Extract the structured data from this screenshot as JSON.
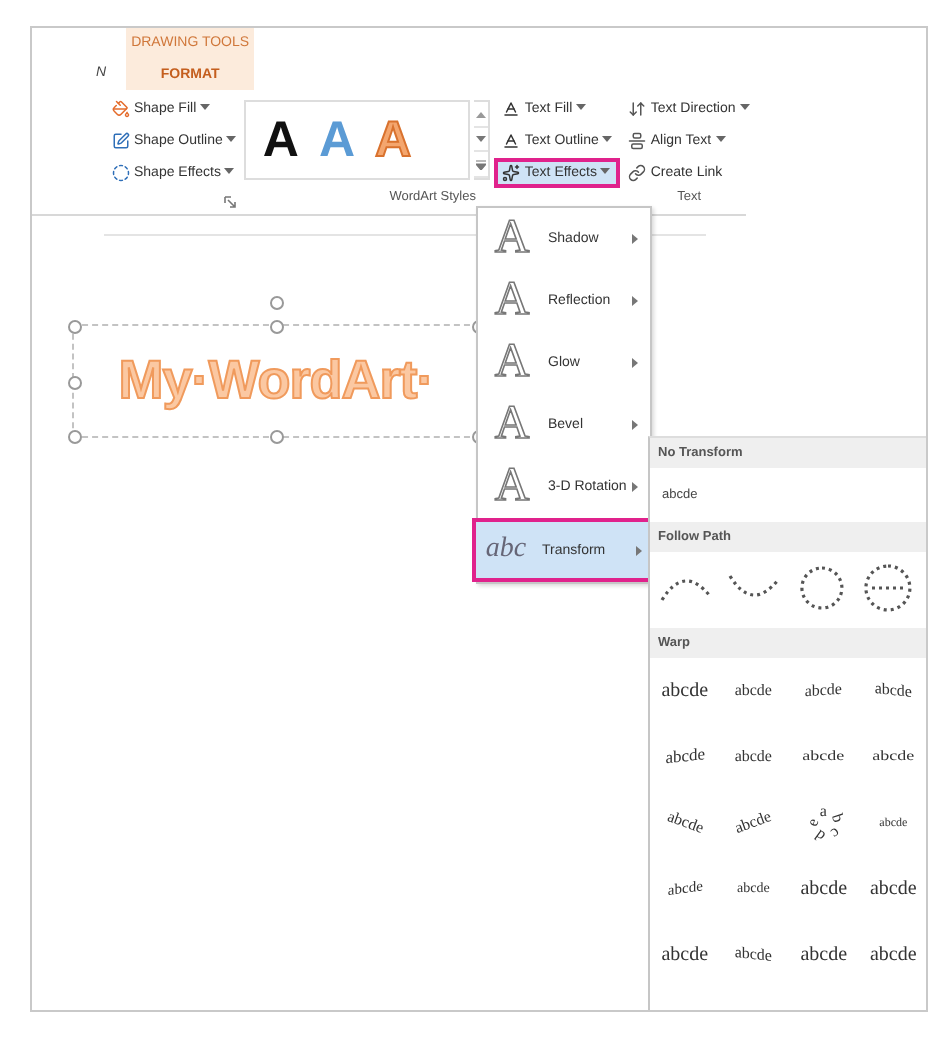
{
  "ribbon": {
    "context_tab": {
      "group": "DRAWING TOOLS",
      "label": "FORMAT",
      "selected": true
    },
    "left_tab": {
      "label": "N"
    },
    "shape_buttons": [
      {
        "label": "Shape Fill",
        "kind": "fill"
      },
      {
        "label": "Shape Outline",
        "kind": "outline"
      },
      {
        "label": "Shape Effects",
        "kind": "effects"
      }
    ],
    "gallery": [
      {
        "letter": "A",
        "kind": "filled",
        "color": "#111111"
      },
      {
        "letter": "A",
        "kind": "filled",
        "color": "#5b9bd5"
      },
      {
        "letter": "A",
        "kind": "outline",
        "color": "#f4a66e"
      }
    ],
    "text_buttons": [
      {
        "label": "Text Fill",
        "kind": "fill",
        "selected": false
      },
      {
        "label": "Text Outline",
        "kind": "outline",
        "selected": false
      },
      {
        "label": "Text Effects",
        "kind": "effects",
        "selected": true
      }
    ],
    "text_group_buttons": [
      {
        "label": "Text Direction",
        "kind": "direction",
        "caret": true
      },
      {
        "label": "Align Text",
        "kind": "align",
        "caret": true
      },
      {
        "label": "Create Link",
        "kind": "link",
        "caret": false
      }
    ],
    "group_labels": [
      "WordArt Styles",
      "Text"
    ]
  },
  "wordart": {
    "text": "My·WordArt·"
  },
  "effects_menu": [
    {
      "icon": "A",
      "label": "Shadow",
      "selected": false
    },
    {
      "icon": "A",
      "label": "Reflection",
      "selected": false
    },
    {
      "icon": "A",
      "label": "Glow",
      "selected": false
    },
    {
      "icon": "A",
      "label": "Bevel",
      "selected": false
    },
    {
      "icon": "A",
      "label": "3-D Rotation",
      "selected": false
    },
    {
      "icon": "abc",
      "label": "Transform",
      "selected": true
    }
  ],
  "transform_menu": {
    "no_transform": {
      "header": "No Transform",
      "item": "abcde"
    },
    "follow_path": {
      "header": "Follow Path",
      "items": [
        {
          "kind": "arch"
        },
        {
          "kind": "valley"
        },
        {
          "kind": "ring"
        },
        {
          "kind": "button"
        }
      ]
    },
    "warp": {
      "header": "Warp",
      "rows": [
        [
          {
            "label": "abcde",
            "kind": "plain"
          },
          {
            "label": "abcde",
            "kind": "small"
          },
          {
            "label": "abcde",
            "kind": "shrink"
          },
          {
            "label": "abcde",
            "kind": "wave"
          }
        ],
        [
          {
            "label": "abcde",
            "kind": "grow"
          },
          {
            "label": "abcde",
            "kind": "small"
          },
          {
            "label": "abcde",
            "kind": "squash"
          },
          {
            "label": "abcde",
            "kind": "squash"
          }
        ],
        [
          {
            "label": "abcde",
            "kind": "arch"
          },
          {
            "label": "abcde",
            "kind": "archdown"
          },
          {
            "label": "abcde",
            "kind": "circle"
          },
          {
            "label": "abcde",
            "kind": "stack"
          }
        ],
        [
          {
            "label": "abcde",
            "kind": "rise"
          },
          {
            "label": "abcde",
            "kind": "tiny"
          },
          {
            "label": "abcde",
            "kind": "plain"
          },
          {
            "label": "abcde",
            "kind": "plain"
          }
        ],
        [
          {
            "label": "abcde",
            "kind": "plain"
          },
          {
            "label": "abcde",
            "kind": "wave"
          },
          {
            "label": "abcde",
            "kind": "plain"
          },
          {
            "label": "abcde",
            "kind": "plain"
          }
        ]
      ]
    }
  }
}
